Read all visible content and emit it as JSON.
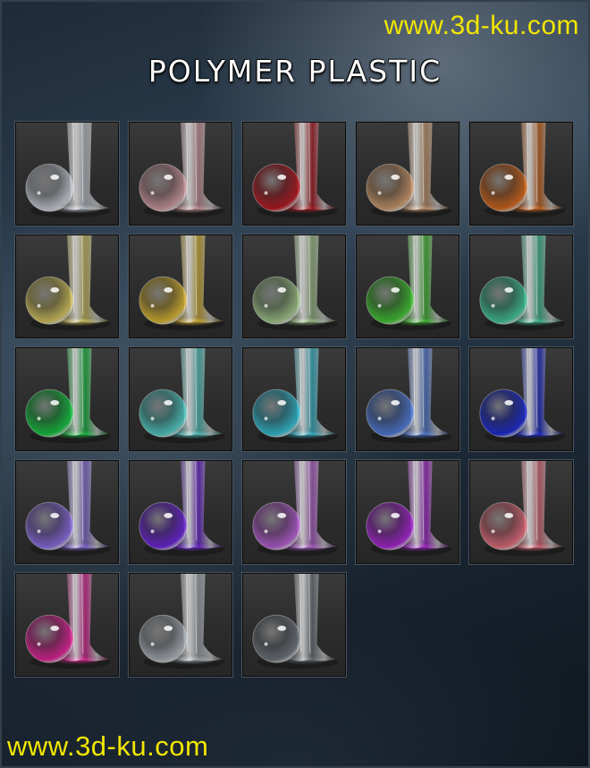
{
  "watermark": {
    "top": "www.3d-ku.com",
    "bottom": "www.3d-ku.com"
  },
  "title": "POLYMER PLASTIC",
  "swatches": [
    {
      "color": "#cfd6e0"
    },
    {
      "color": "#d9a0a8"
    },
    {
      "color": "#c0141e"
    },
    {
      "color": "#d8a070"
    },
    {
      "color": "#e06a18"
    },
    {
      "color": "#e0d060"
    },
    {
      "color": "#e8c030"
    },
    {
      "color": "#a8d090"
    },
    {
      "color": "#40d030"
    },
    {
      "color": "#40d0a0"
    },
    {
      "color": "#10d040"
    },
    {
      "color": "#50d8d0"
    },
    {
      "color": "#30c8e0"
    },
    {
      "color": "#5080e8"
    },
    {
      "color": "#1828e0"
    },
    {
      "color": "#9070f0"
    },
    {
      "color": "#7020e8"
    },
    {
      "color": "#c060e0"
    },
    {
      "color": "#b020e0"
    },
    {
      "color": "#f07080"
    },
    {
      "color": "#f020a0"
    },
    {
      "color": "#b0b8c0"
    },
    {
      "color": "#707880"
    }
  ]
}
